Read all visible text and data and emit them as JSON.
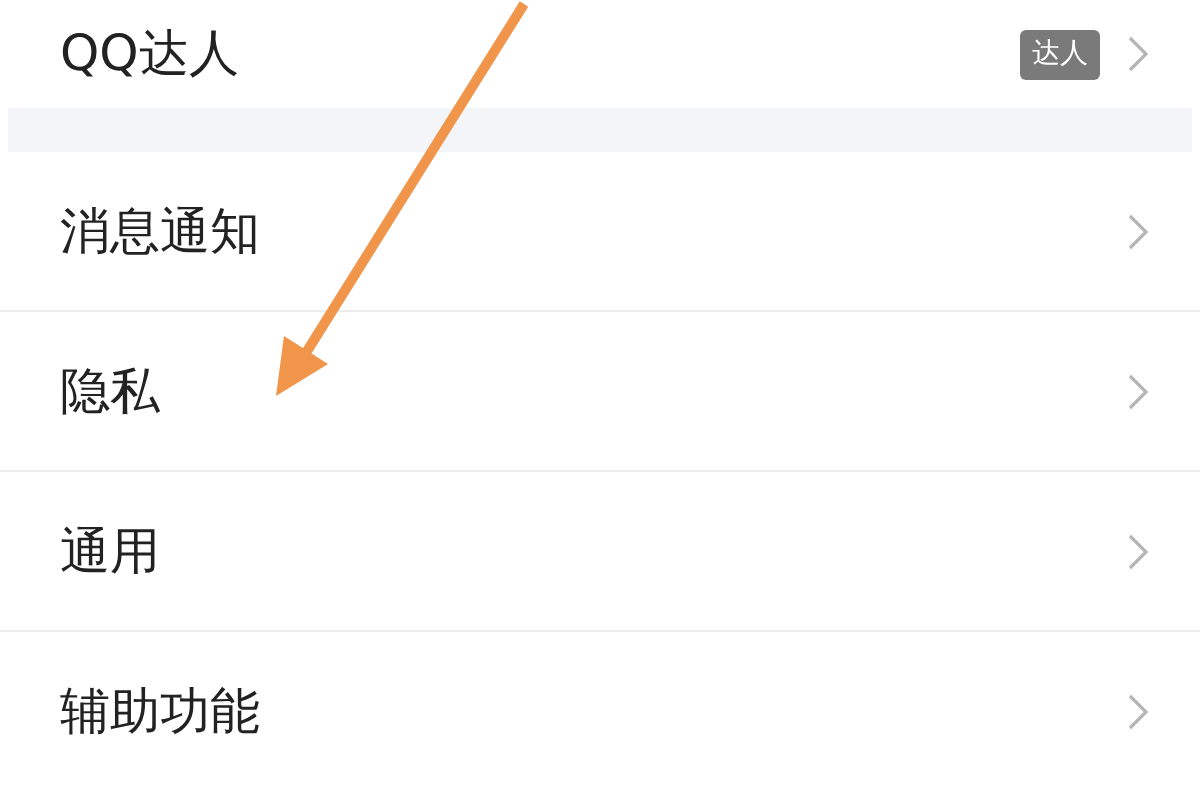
{
  "settings_groups": [
    {
      "items": [
        {
          "label": "QQ达人",
          "badge": "达人"
        }
      ]
    },
    {
      "items": [
        {
          "label": "消息通知"
        },
        {
          "label": "隐私"
        },
        {
          "label": "通用"
        },
        {
          "label": "辅助功能"
        }
      ]
    }
  ]
}
